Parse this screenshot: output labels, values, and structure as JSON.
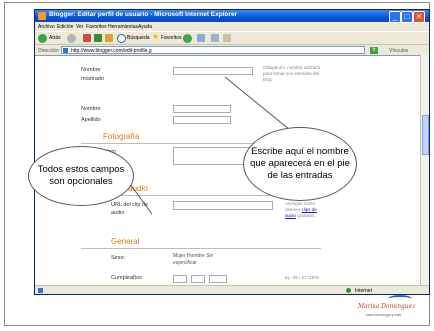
{
  "window": {
    "title": "Blogger: Editar perfil de usuario - Microsoft Internet Explorer",
    "min": "_",
    "max": "□",
    "close": "✕"
  },
  "menu": [
    "Archivo",
    "Edición",
    "Ver",
    "Favoritos",
    "Herramientas",
    "Ayuda"
  ],
  "toolbar": {
    "back": "Atrás",
    "search": "Búsqueda",
    "favorites": "Favoritos"
  },
  "address": {
    "label": "Dirección",
    "url": "http://www.blogger.com/edit-profile.g",
    "go": "Ir",
    "links": "Vínculos"
  },
  "form": {
    "nombre_label": "Nombre",
    "mostrado_label": "mostrado",
    "nombre_note": "Obligatorio; nombre utilizado para firmar sus entradas del blog.",
    "nombre2_label": "Nombre",
    "apellido_label": "Apellido",
    "fotografia_heading": "Fotografía",
    "foto_label": "la foto",
    "clip_heading": "Clip de audio",
    "clip_url_label": "URL del clip de",
    "clip_audio_label": "audio",
    "clip_note_a": "Averigüe cómo",
    "clip_note_b": "obtener",
    "clip_note_link": "clips de",
    "clip_note_c": "audio",
    "clip_note_d": "gratuitos.",
    "general_heading": "General",
    "sexo_label": "Sexo:",
    "sexo_options": "Mujer  Hombre  Sin",
    "sexo_options_2": "especificar",
    "cumple_label": "Cumpleaños",
    "cumple_note": "Ej.: 09 / 27 /1976"
  },
  "status": {
    "zone": "Internet"
  },
  "callouts": {
    "right": "Escribe aquí el nombre que aparecerá en el pie de las entradas",
    "left": "Todos estos campos son opcionales"
  },
  "branding": {
    "name": "Marisa Dominguez",
    "sub": "educ tecnología y más"
  }
}
